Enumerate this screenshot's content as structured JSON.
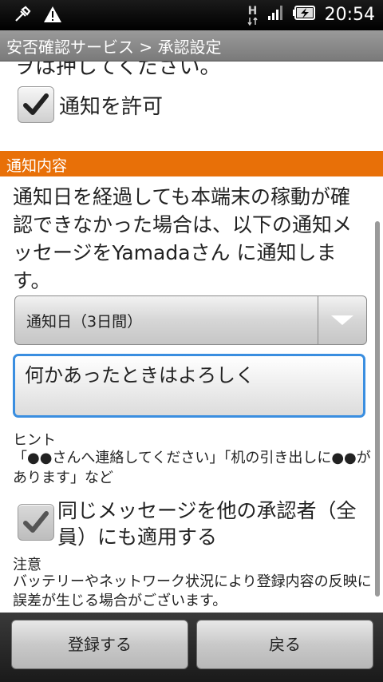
{
  "status_bar": {
    "left_icons": [
      "usb-debug-icon",
      "warning-icon"
    ],
    "right_icons": [
      "hspa-icon",
      "signal-icon",
      "battery-charging-icon"
    ],
    "network_label": "H",
    "time": "20:54"
  },
  "title_bar": {
    "title": "安否確認サービス > 承認設定"
  },
  "content": {
    "cut_text": "ヲは押してください。",
    "allow_notification": {
      "label": "通知を許可",
      "checked": true
    },
    "section_header": "通知内容",
    "description": "通知日を経過しても本端末の稼動が確認できなかった場合は、以下の通知メッセージをYamadaさん に通知します。",
    "dropdown": {
      "selected": "通知日（3日間）"
    },
    "message_input": {
      "value": "何かあったときはよろしく"
    },
    "hint": {
      "title": "ヒント",
      "body": "「●●さんへ連絡してください」「机の引き出しに●●があります」など"
    },
    "apply_all": {
      "label": "同じメッセージを他の承認者（全員）にも適用する",
      "checked": true
    },
    "note": {
      "title": "注意",
      "body": "バッテリーやネットワーク状況により登録内容の反映に誤差が生じる場合がございます。"
    }
  },
  "bottom_bar": {
    "register_label": "登録する",
    "back_label": "戻る"
  },
  "colors": {
    "section_header": "#e87008",
    "input_focus": "#3a8ee0"
  }
}
